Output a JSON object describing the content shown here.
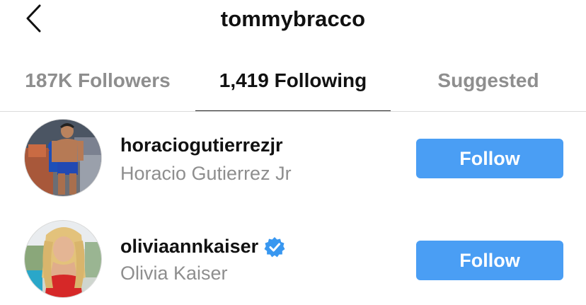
{
  "header": {
    "title": "tommybracco",
    "back_icon": "chevron-left-icon"
  },
  "tabs": [
    {
      "label": "187K Followers",
      "active": false
    },
    {
      "label": "1,419 Following",
      "active": true
    },
    {
      "label": "Suggested",
      "active": false
    }
  ],
  "users": [
    {
      "username": "horaciogutierrezjr",
      "full_name": "Horacio Gutierrez Jr",
      "verified": false,
      "button_label": "Follow"
    },
    {
      "username": "oliviaannkaiser",
      "full_name": "Olivia Kaiser",
      "verified": true,
      "verified_icon": "verified-badge-icon",
      "button_label": "Follow"
    }
  ],
  "colors": {
    "follow_button": "#4a9ef4",
    "verified_badge": "#3897f0",
    "inactive_tab": "#8e8e8e",
    "secondary_text": "#8e8e8e"
  }
}
